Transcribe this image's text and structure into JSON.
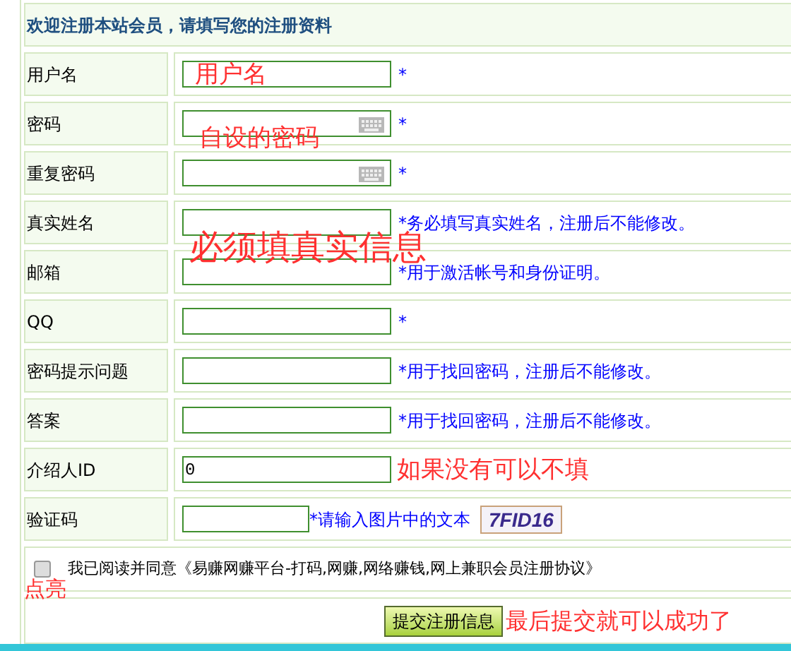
{
  "header": "欢迎注册本站会员，请填写您的注册资料",
  "rows": [
    {
      "label": "用户名",
      "kind": "text",
      "value": "",
      "hint": "*",
      "annotation": {
        "text": "用户名",
        "kind": "inline"
      }
    },
    {
      "label": "密码",
      "kind": "password",
      "value": "",
      "hint": "*",
      "annotation": {
        "text": "自设的密码",
        "kind": "below"
      }
    },
    {
      "label": "重复密码",
      "kind": "password",
      "value": "",
      "hint": "*"
    },
    {
      "label": "真实姓名",
      "kind": "text",
      "value": "",
      "hint": "*务必填写真实姓名，注册后不能修改。",
      "annotation": {
        "text": "必须填真实信息",
        "kind": "large"
      }
    },
    {
      "label": "邮箱",
      "kind": "text",
      "value": "",
      "hint": "*用于激活帐号和身份证明。"
    },
    {
      "label": "QQ",
      "kind": "text",
      "value": "",
      "hint": "*"
    },
    {
      "label": "密码提示问题",
      "kind": "text",
      "value": "",
      "hint": "*用于找回密码，注册后不能修改。"
    },
    {
      "label": "答案",
      "kind": "text",
      "value": "",
      "hint": "*用于找回密码，注册后不能修改。"
    },
    {
      "label": "介绍人ID",
      "kind": "text",
      "value": "0",
      "hint": "",
      "annotation": {
        "text": "如果没有可以不填",
        "kind": "after"
      }
    },
    {
      "label": "验证码",
      "kind": "captcha",
      "value": "",
      "hint": "*请输入图片中的文本",
      "captcha": "7FID16"
    }
  ],
  "agreement": {
    "checked": false,
    "text": "我已阅读并同意《易赚网赚平台-打码,网赚,网络赚钱,网上兼职会员注册协议》",
    "annotation": "点亮"
  },
  "submit": {
    "label": "提交注册信息",
    "annotation": "最后提交就可以成功了"
  }
}
